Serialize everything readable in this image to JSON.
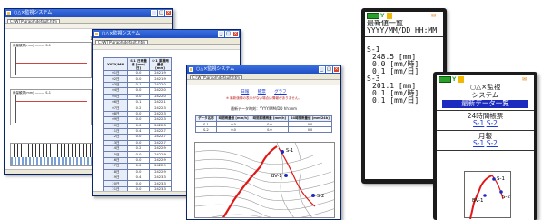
{
  "win1": {
    "title": "○△×監視システム",
    "addr_text": "C:\\WTP\\graph\\default.htm",
    "graph_title": "1ヶ月観測",
    "panel1_label": "雨量観測(mm) ——— S-1",
    "panel2_label": "雨量観測(mm) ——— S-1"
  },
  "win2": {
    "title": "○△×監視システム",
    "addr_text": "C:\\WTP\\graph\\default.htm",
    "table": {
      "headers": [
        "YYYY/MM",
        "S-1\n日雨量値\n[mm/日]",
        "S-1\n累積雨量値\n[mm]"
      ],
      "rows": [
        [
          "01日",
          "0.0",
          "2421.9"
        ],
        [
          "02日",
          "0.0",
          "2421.9"
        ],
        [
          "03日",
          "0.1",
          "2422.0"
        ],
        [
          "04日",
          "0.0",
          "2422.0"
        ],
        [
          "05日",
          "0.0",
          "2422.0"
        ],
        [
          "06日",
          "0.1",
          "2422.1"
        ],
        [
          "07日",
          "0.2",
          "2422.3"
        ],
        [
          "08日",
          "0.0",
          "2422.3"
        ],
        [
          "09日",
          "0.0",
          "2422.3"
        ],
        [
          "10日",
          "0.0",
          "2422.3"
        ],
        [
          "11日",
          "0.4",
          "2422.7"
        ],
        [
          "12日",
          "0.0",
          "2422.7"
        ],
        [
          "13日",
          "0.0",
          "2422.7"
        ],
        [
          "14日",
          "0.2",
          "2422.9"
        ],
        [
          "15日",
          "0.0",
          "2422.9"
        ],
        [
          "16日",
          "0.0",
          "2422.9"
        ],
        [
          "17日",
          "0.0",
          "2422.9"
        ],
        [
          "18日",
          "0.0",
          "2422.9"
        ],
        [
          "19日",
          "0.4",
          "2423.3"
        ],
        [
          "20日",
          "0.0",
          "2423.3"
        ],
        [
          "21日",
          "0.0",
          "2423.3"
        ],
        [
          "22日",
          "0.0",
          "2423.3"
        ],
        [
          "23日",
          "0.0",
          "2423.3"
        ],
        [
          "24日",
          "0.0",
          "2423.3"
        ],
        [
          "25日",
          "0.0",
          "2423.3"
        ]
      ]
    }
  },
  "win3": {
    "title": "○△×監視システム",
    "addr_text": "C:\\WTP\\graph\\default.htm",
    "menu": [
      "日報",
      "帳票",
      "グラフ"
    ],
    "note": "※ 最新値欄の表示がない場合は情報がありません。",
    "time_label": "最新データ時刻：YYYY/MM/DD hh:mm",
    "table": {
      "headers": [
        "データ名称",
        "時間雨量値\n[mm/h]",
        "時間累積雨量\n[mm/h]",
        "24時間雨量値\n[mm/24h]"
      ],
      "rows": [
        [
          "S-1",
          "0.0",
          "0.0",
          "0.0"
        ],
        [
          "S-2",
          "0.0",
          "0.0",
          "0.0"
        ]
      ]
    },
    "map_labels": {
      "s1": "S-1",
      "bv1": "BV-1",
      "s2": "S-2"
    }
  },
  "phone1": {
    "header_title": "最新値一覧",
    "header_time": "YYYY/MM/DD HH:MM",
    "sections": [
      {
        "name": "S-1",
        "l1": "248.5 [mm]",
        "l2": "0.0 [mm/時]",
        "l3": "0.1 [mm/日]"
      },
      {
        "name": "S-3",
        "l1": "201.1 [mm]",
        "l2": "0.1 [mm/時]",
        "l3": "0.1 [mm/日]"
      }
    ]
  },
  "phone2": {
    "system_line1": "○△×監視",
    "system_line2": "システム",
    "latest_menu": "最新データ一覧",
    "report24_label": "24時間帳票",
    "monthly_label": "月報",
    "link_s1": "S-1",
    "link_s2": "S-2",
    "map_labels": {
      "s1": "S-1",
      "bv1": "BV-1",
      "s2": "S-2"
    }
  },
  "colors": {
    "title_blue": "#1f4fc2",
    "route_red": "#e01818",
    "link_blue": "#1a3ad8",
    "battery_green": "#2aa02a"
  }
}
